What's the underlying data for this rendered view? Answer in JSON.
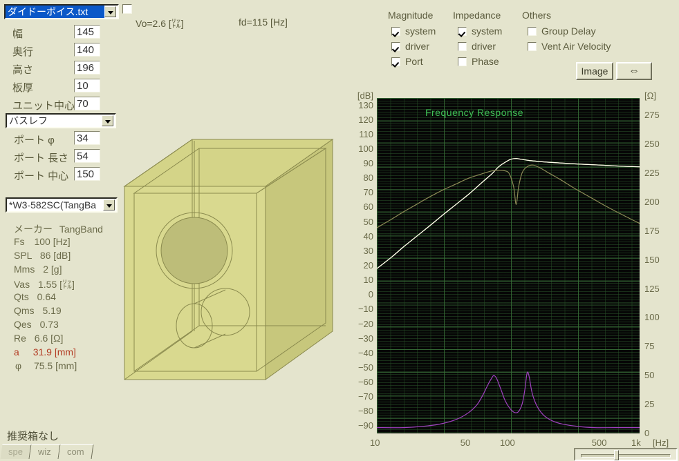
{
  "file_combo": {
    "value": "ダイドーボイス.txt",
    "selected": true
  },
  "top_checkbox": {
    "name": "unnamed-toggle",
    "checked": false
  },
  "readouts": {
    "vo": "Vo=2.6 [㍑]",
    "fd": "fd=115 [Hz]"
  },
  "box_dims": {
    "rows": [
      {
        "label": "幅",
        "value": "145"
      },
      {
        "label": "奥行",
        "value": "140"
      },
      {
        "label": "高さ",
        "value": "196"
      },
      {
        "label": "板厚",
        "value": "10"
      },
      {
        "label": "ユニット中心",
        "value": "70"
      }
    ]
  },
  "enclosure_type": {
    "value": "バスレフ"
  },
  "port": {
    "rows": [
      {
        "label": "ポート φ",
        "value": "34"
      },
      {
        "label": "ポート 長さ",
        "value": "54"
      },
      {
        "label": "ポート 中心",
        "value": "150"
      }
    ]
  },
  "driver_combo": {
    "value": "*W3-582SC(TangBa"
  },
  "driver_specs": [
    {
      "name": "メーカー",
      "value": "TangBand",
      "hl": false
    },
    {
      "name": "Fs",
      "value": "100 [Hz]",
      "hl": false
    },
    {
      "name": "SPL",
      "value": "86 [dB]",
      "hl": false
    },
    {
      "name": "Mms",
      "value": "2 [g]",
      "hl": false
    },
    {
      "name": "Vas",
      "value": "1.55 [㍑]",
      "hl": false
    },
    {
      "name": "Qts",
      "value": "0.64",
      "hl": false
    },
    {
      "name": "Qms",
      "value": "5.19",
      "hl": false
    },
    {
      "name": "Qes",
      "value": "0.73",
      "hl": false
    },
    {
      "name": "Re",
      "value": "6.6 [Ω]",
      "hl": false
    },
    {
      "name": "a",
      "value": "31.9 [mm]",
      "hl": true
    },
    {
      "name": "φ",
      "value": "75.5 [mm]",
      "hl": false
    }
  ],
  "status": {
    "text": "推奨箱なし"
  },
  "tabs": [
    {
      "label": "spe",
      "active": true
    },
    {
      "label": "wiz",
      "active": false
    },
    {
      "label": "com",
      "active": false
    }
  ],
  "options": {
    "groups": [
      {
        "title": "Magnitude",
        "items": [
          {
            "label": "system",
            "checked": true
          },
          {
            "label": "driver",
            "checked": true
          },
          {
            "label": "Port",
            "checked": true
          }
        ]
      },
      {
        "title": "Impedance",
        "items": [
          {
            "label": "system",
            "checked": true
          },
          {
            "label": "driver",
            "checked": false
          },
          {
            "label": "Phase",
            "checked": false
          }
        ]
      },
      {
        "title": "Others",
        "items": [
          {
            "label": "Group Delay",
            "checked": false
          },
          {
            "label": "Vent Air Velocity",
            "checked": false
          }
        ]
      }
    ],
    "image_button": "Image",
    "swap_button": "⇔"
  },
  "chart_data": {
    "type": "line",
    "title": "Frequency Response",
    "xlabel": "[Hz]",
    "ylabel": "[dB]",
    "y2label": "[Ω]",
    "xscale": "log",
    "xlim": [
      10,
      1000
    ],
    "xticks": [
      10,
      50,
      100,
      500,
      1000
    ],
    "xticklabels": [
      "10",
      "50",
      "100",
      "500",
      "1k"
    ],
    "ylim": [
      -95,
      135
    ],
    "yticks": [
      130,
      120,
      110,
      100,
      90,
      80,
      70,
      60,
      50,
      40,
      30,
      20,
      10,
      0,
      -10,
      -20,
      -30,
      -40,
      -50,
      -60,
      -70,
      -80,
      -90
    ],
    "y2lim": [
      0,
      290
    ],
    "y2ticks": [
      275,
      250,
      225,
      200,
      175,
      150,
      125,
      100,
      75,
      50,
      25,
      0
    ],
    "grid": true,
    "legend": "none",
    "colors": {
      "system": "#f2f2a0",
      "driver": "#fffff0",
      "port": "#8d8a56",
      "impedance": "#a040c0",
      "title": "#3fbf56",
      "background": "#060606",
      "grid": "#2b5a2b"
    },
    "series": [
      {
        "name": "Magnitude system",
        "color": "#f2f2a0",
        "axis": "left",
        "points": [
          [
            10,
            18
          ],
          [
            13,
            26
          ],
          [
            16,
            33
          ],
          [
            20,
            40
          ],
          [
            25,
            47
          ],
          [
            32,
            55
          ],
          [
            40,
            62
          ],
          [
            50,
            69
          ],
          [
            63,
            77
          ],
          [
            75,
            83
          ],
          [
            85,
            88
          ],
          [
            95,
            91
          ],
          [
            105,
            93
          ],
          [
            115,
            93.5
          ],
          [
            125,
            93
          ],
          [
            150,
            92
          ],
          [
            200,
            91
          ],
          [
            300,
            90
          ],
          [
            500,
            89
          ],
          [
            700,
            88.3
          ],
          [
            1000,
            87.8
          ]
        ]
      },
      {
        "name": "Magnitude driver",
        "color": "#fffff0",
        "axis": "left",
        "points": [
          [
            10,
            18
          ],
          [
            13,
            26
          ],
          [
            16,
            33
          ],
          [
            20,
            40
          ],
          [
            25,
            47
          ],
          [
            32,
            55
          ],
          [
            40,
            62
          ],
          [
            50,
            69
          ],
          [
            63,
            77
          ],
          [
            75,
            83
          ],
          [
            85,
            88
          ],
          [
            95,
            91
          ],
          [
            105,
            93
          ],
          [
            115,
            93.5
          ],
          [
            125,
            93
          ],
          [
            150,
            92
          ],
          [
            200,
            91
          ],
          [
            300,
            90
          ],
          [
            500,
            89
          ],
          [
            700,
            88.3
          ],
          [
            1000,
            87.8
          ]
        ]
      },
      {
        "name": "Magnitude port",
        "color": "#8d8a56",
        "axis": "left",
        "points": [
          [
            10,
            46
          ],
          [
            13,
            52
          ],
          [
            16,
            57
          ],
          [
            20,
            62
          ],
          [
            25,
            67
          ],
          [
            32,
            72
          ],
          [
            40,
            76
          ],
          [
            50,
            80
          ],
          [
            63,
            83
          ],
          [
            75,
            85
          ],
          [
            85,
            85.5
          ],
          [
            95,
            85
          ],
          [
            102,
            83
          ],
          [
            110,
            74
          ],
          [
            115,
            62
          ],
          [
            120,
            74
          ],
          [
            128,
            84
          ],
          [
            140,
            88
          ],
          [
            155,
            89
          ],
          [
            175,
            87
          ],
          [
            200,
            84
          ],
          [
            250,
            79
          ],
          [
            320,
            73
          ],
          [
            420,
            67
          ],
          [
            550,
            61
          ],
          [
            700,
            56
          ],
          [
            1000,
            49
          ]
        ]
      },
      {
        "name": "Impedance system",
        "color": "#a040c0",
        "axis": "right",
        "points": [
          [
            10,
            5
          ],
          [
            16,
            5
          ],
          [
            22,
            6
          ],
          [
            30,
            8
          ],
          [
            40,
            12
          ],
          [
            50,
            18
          ],
          [
            58,
            25
          ],
          [
            64,
            33
          ],
          [
            70,
            42
          ],
          [
            75,
            48
          ],
          [
            78,
            50
          ],
          [
            82,
            47
          ],
          [
            88,
            38
          ],
          [
            95,
            28
          ],
          [
            104,
            21
          ],
          [
            112,
            18
          ],
          [
            120,
            19
          ],
          [
            128,
            26
          ],
          [
            134,
            38
          ],
          [
            138,
            50
          ],
          [
            141,
            53
          ],
          [
            145,
            48
          ],
          [
            152,
            35
          ],
          [
            165,
            24
          ],
          [
            185,
            16
          ],
          [
            215,
            11
          ],
          [
            260,
            8
          ],
          [
            340,
            6
          ],
          [
            450,
            5
          ],
          [
            650,
            5
          ],
          [
            1000,
            5
          ]
        ]
      }
    ]
  }
}
